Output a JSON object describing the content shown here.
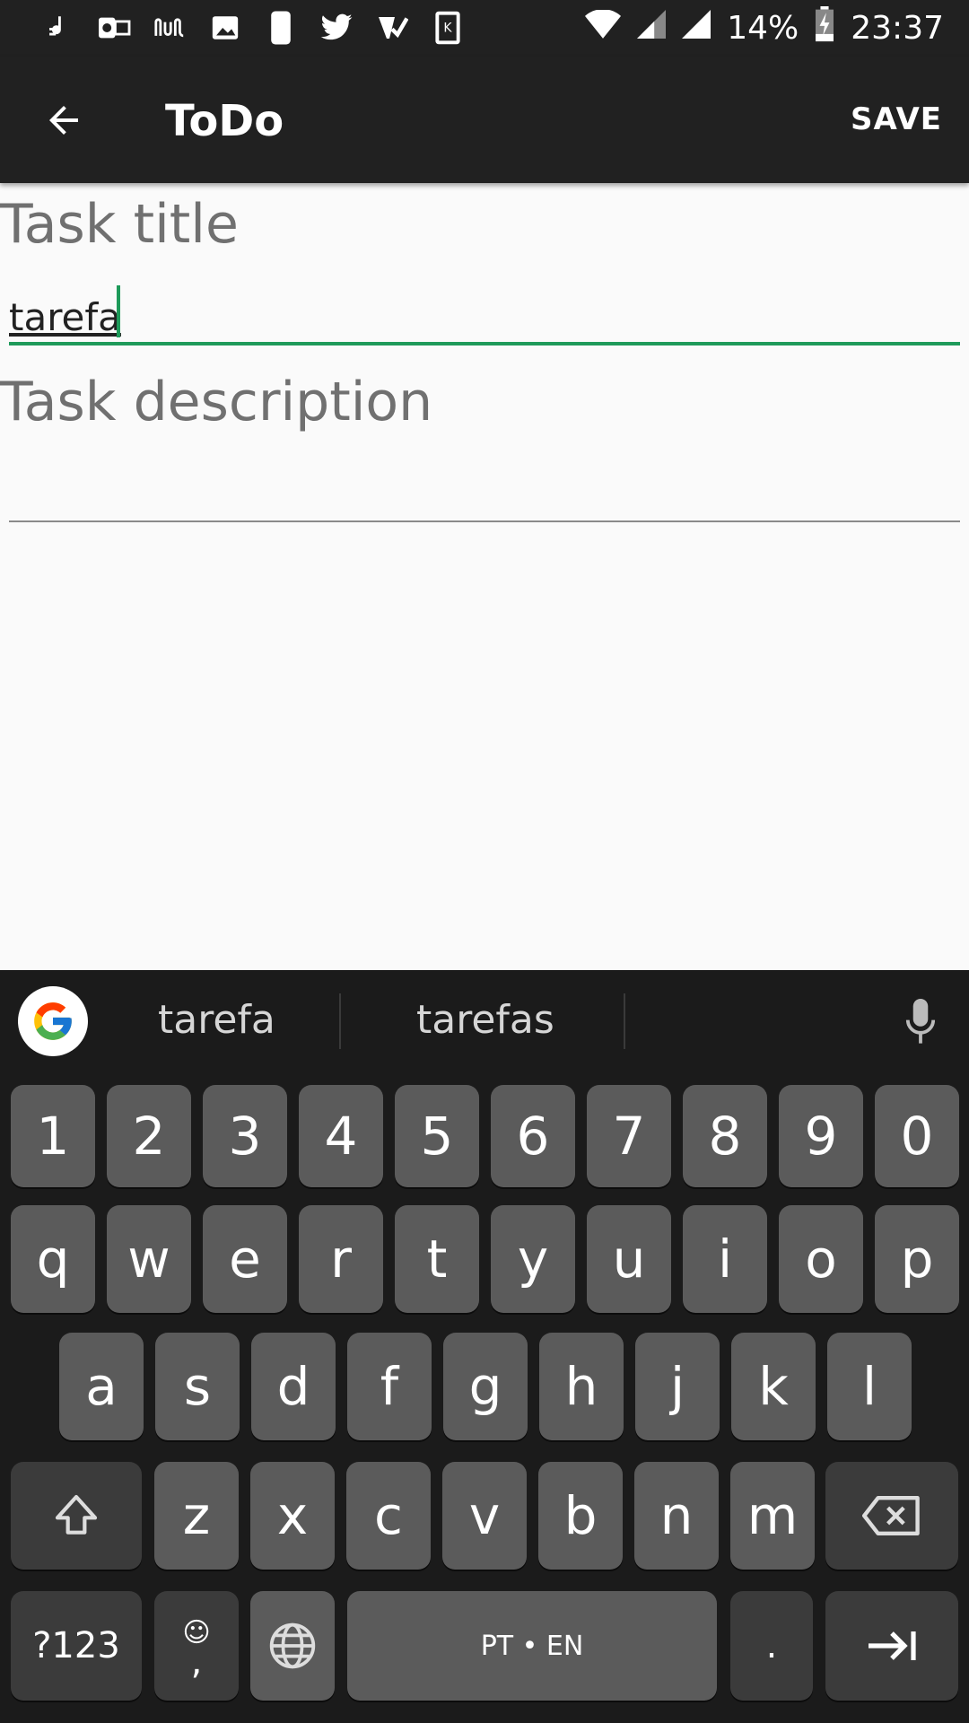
{
  "status_bar": {
    "battery": "14%",
    "time": "23:37",
    "icons": [
      "music-note-icon",
      "outlook-icon",
      "nubank-icon",
      "image-icon",
      "moon-icon",
      "twitter-icon",
      "check-tag-icon",
      "kindle-icon",
      "wifi-icon",
      "signal-icon",
      "signal-icon",
      "battery-charging-icon"
    ]
  },
  "app_bar": {
    "title": "ToDo",
    "save_label": "SAVE",
    "back_icon": "arrow-back-icon"
  },
  "form": {
    "title_label": "Task title",
    "title_value": "tarefa",
    "description_label": "Task description",
    "description_value": ""
  },
  "keyboard": {
    "suggestions": [
      "tarefa",
      "tarefas"
    ],
    "row_numbers": [
      "1",
      "2",
      "3",
      "4",
      "5",
      "6",
      "7",
      "8",
      "9",
      "0"
    ],
    "row1": [
      "q",
      "w",
      "e",
      "r",
      "t",
      "y",
      "u",
      "i",
      "o",
      "p"
    ],
    "row2": [
      "a",
      "s",
      "d",
      "f",
      "g",
      "h",
      "j",
      "k",
      "l"
    ],
    "row3": [
      "z",
      "x",
      "c",
      "v",
      "b",
      "n",
      "m"
    ],
    "symbols_label": "?123",
    "comma_label": ",",
    "space_label": "PT • EN",
    "period_label": ".",
    "colors": {
      "background": "#1b1b1b",
      "key": "#5b5b5b",
      "key_dark": "#3b3b3b"
    }
  },
  "colors": {
    "accent": "#1e9a5a",
    "app_bar": "#212121",
    "label": "#707070"
  }
}
